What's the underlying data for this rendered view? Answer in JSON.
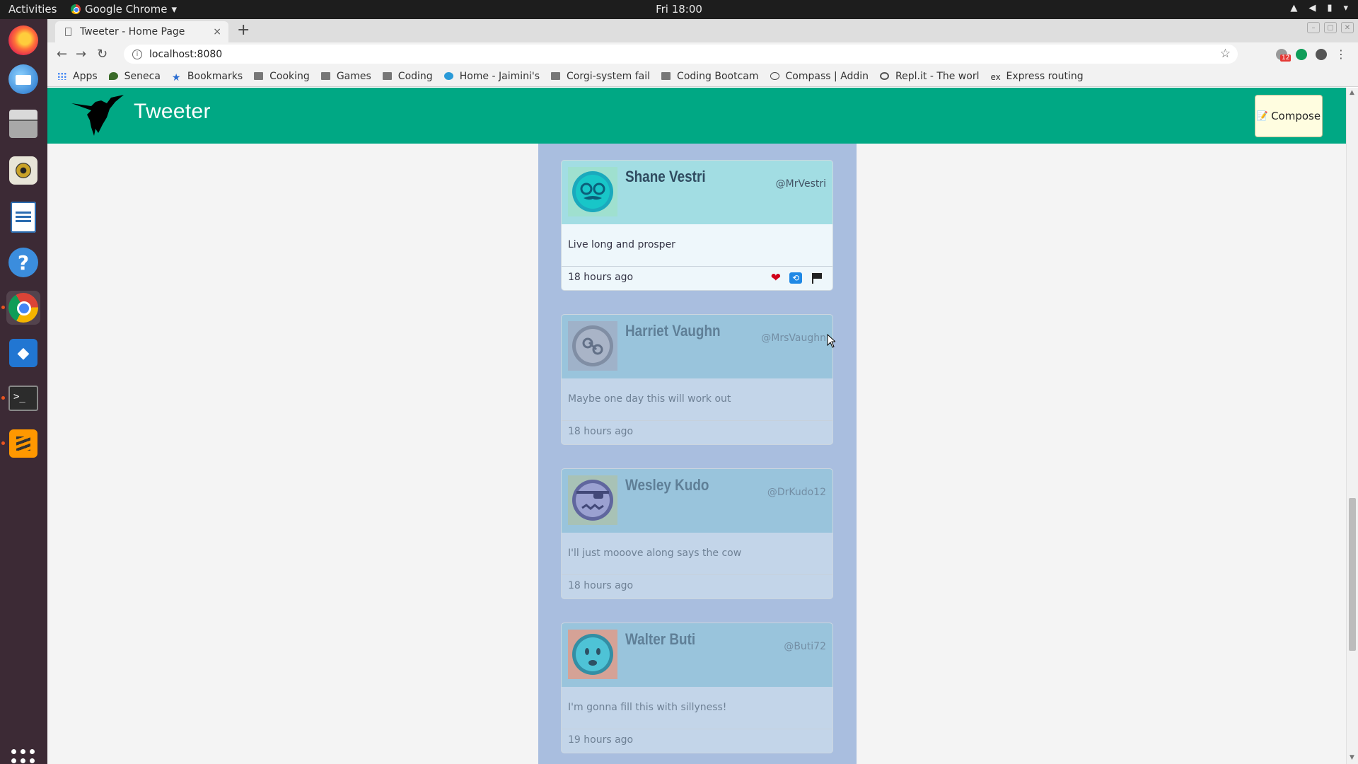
{
  "system_bar": {
    "activities": "Activities",
    "app_name": "Google Chrome",
    "app_arrow": "▾",
    "clock": "Fri 18:00",
    "tray_icons": [
      "wifi-icon",
      "volume-icon",
      "battery-icon",
      "power-menu-icon"
    ]
  },
  "dock": {
    "items": [
      "Firefox",
      "Thunderbird",
      "Files",
      "Rhythmbox",
      "LibreOffice Writer",
      "Help",
      "Google Chrome",
      "Visual Studio Code",
      "Terminal",
      "Sublime Text"
    ],
    "active": "Google Chrome",
    "terminal_glyph": ">_",
    "vscode_glyph": "◆"
  },
  "browser": {
    "tab_title": "Tweeter - Home Page",
    "tab_close": "×",
    "new_tab": "+",
    "url": "localhost:8080",
    "info_glyph": "i",
    "ext_badge": "12",
    "bookmarks": [
      {
        "label": "Apps",
        "icon": "apps-grid-icon"
      },
      {
        "label": "Seneca",
        "icon": "leaf-icon"
      },
      {
        "label": "Bookmarks",
        "icon": "star-icon"
      },
      {
        "label": "Cooking",
        "icon": "folder-icon"
      },
      {
        "label": "Games",
        "icon": "folder-icon"
      },
      {
        "label": "Coding",
        "icon": "folder-icon"
      },
      {
        "label": "Home - Jaimini's",
        "icon": "blue-site-icon"
      },
      {
        "label": "Corgi-system fail",
        "icon": "folder-icon"
      },
      {
        "label": "Coding Bootcam",
        "icon": "folder-icon"
      },
      {
        "label": "Compass | Addin",
        "icon": "compass-icon"
      },
      {
        "label": "Repl.it - The worl",
        "icon": "repl-icon"
      },
      {
        "label": "Express routing",
        "icon": "ex-icon"
      }
    ]
  },
  "app": {
    "brand": "Tweeter",
    "compose_label": "Compose",
    "compose_glyph": "📝"
  },
  "tweets": [
    {
      "name": "Shane Vestri",
      "handle": "@MrVestri",
      "text": "Live long and prosper",
      "time": "18 hours ago",
      "hovered": true,
      "avatar_bg": "#a2dde3"
    },
    {
      "name": "Harriet Vaughn",
      "handle": "@MrsVaughn",
      "text": "Maybe one day this will work out",
      "time": "18 hours ago",
      "hovered": false,
      "avatar_bg": "#9fb2c8"
    },
    {
      "name": "Wesley Kudo",
      "handle": "@DrKudo12",
      "text": "I'll just mooove along says the cow",
      "time": "18 hours ago",
      "hovered": false,
      "avatar_bg": "#a8c3b3"
    },
    {
      "name": "Walter Buti",
      "handle": "@Buti72",
      "text": "I'm gonna fill this with sillyness!",
      "time": "19 hours ago",
      "hovered": false,
      "avatar_bg": "#d9a090"
    }
  ],
  "tweet_actions": {
    "like": "❤",
    "retweet": "🔄",
    "flag": "flag-icon"
  },
  "colors": {
    "nav_bg": "#00a884",
    "feed_bg": "#a9bedf",
    "tweet_header": "#a2dde3",
    "compose_bg": "#fffde0"
  }
}
